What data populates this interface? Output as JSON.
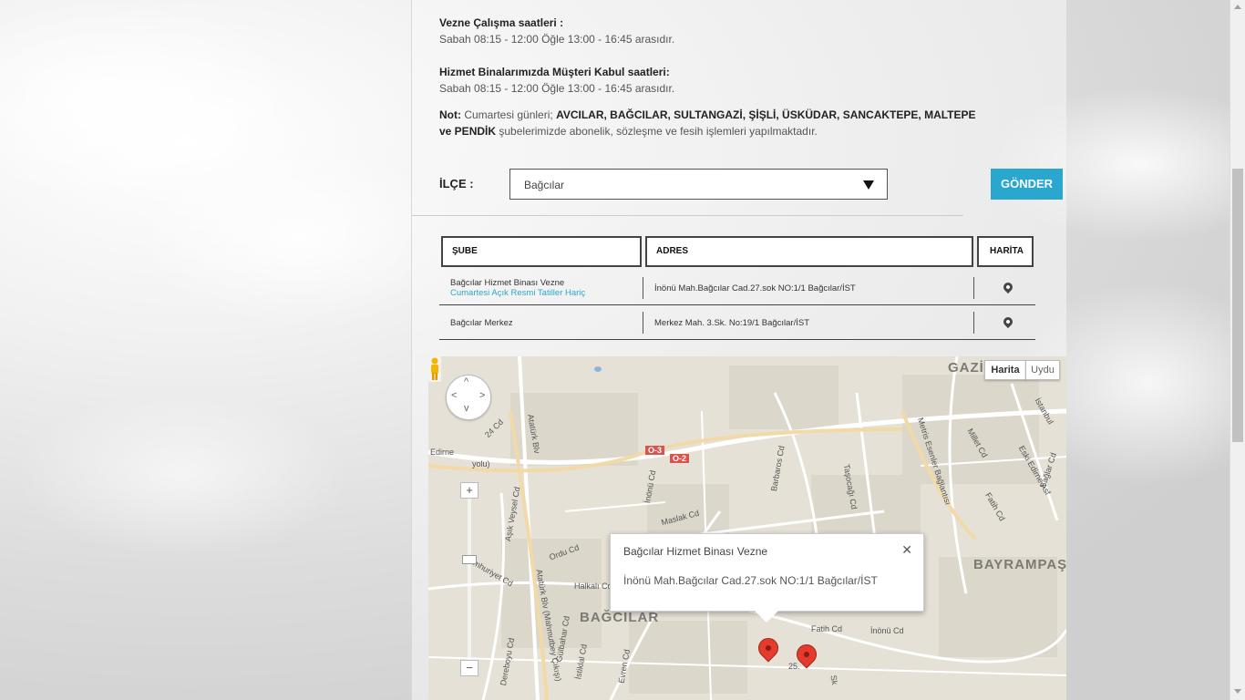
{
  "hours": {
    "cashier_title": "Vezne Çalışma saatleri :",
    "cashier_text": "Sabah 08:15 - 12:00 Öğle 13:00 - 16:45 arasıdır.",
    "service_title": "Hizmet Binalarımızda Müşteri Kabul saatleri:",
    "service_text": "Sabah 08:15 - 12:00 Öğle 13:00 - 16:45 arasıdır."
  },
  "note": {
    "label": "Not:",
    "prefix": "Cumartesi günleri;",
    "districts": "AVCILAR, BAĞCILAR, SULTANGAZİ, ŞİŞLİ, ÜSKÜDAR, SANCAKTEPE, MALTEPE",
    "districts2": "ve PENDİK",
    "suffix": "şubelerimizde abonelik, sözleşme ve fesih işlemleri yapılmaktadır."
  },
  "filter": {
    "label": "İLÇE :",
    "selected": "Bağcılar",
    "button": "GÖNDER"
  },
  "table": {
    "headers": [
      "ŞUBE",
      "ADRES",
      "HARİTA"
    ],
    "rows": [
      {
        "name": "Bağcılar Hizmet Binası Vezne",
        "sub": "Cumartesi Açık Resmi Tatiller Hariç",
        "address": "İnönü Mah.Bağcılar Cad.27.sok NO:1/1 Bağcılar/İST"
      },
      {
        "name": "Bağcılar Merkez",
        "sub": "",
        "address": "Merkez Mah. 3.Sk. No:19/1 Bağcılar/İST"
      }
    ]
  },
  "map": {
    "type_map": "Harita",
    "type_sat": "Uydu",
    "zoom_in": "+",
    "zoom_out": "−",
    "infowindow_title": "Bağcılar Hizmet Binası Vezne",
    "infowindow_address": "İnönü Mah.Bağcılar Cad.27.sok NO:1/1 Bağcılar/İST",
    "close": "✕",
    "areas": [
      "GAZİ",
      "BAYRAMPAŞA",
      "BAĞCILAR"
    ],
    "labels": [
      "Edirne",
      "yolu)",
      "24 Cd",
      "Atatürk Blv",
      "O-3",
      "O-2",
      "Maslak Cd",
      "İnönü Cd",
      "Barbaros Cd",
      "Taşocağı Cd",
      "Metris Esenler Bağlantısı",
      "Millet Cd",
      "Eski Edirne Asf",
      "Fatih Cd",
      "Aşık Veysel Cd",
      "Ordu Cd",
      "Halkalı Cd",
      "Cumhuriyet Cd",
      "Atatürk Blv (Mahmutbey Çıkışı)",
      "Gülbahar Cd",
      "Dereboyu Cd",
      "İstiklal Cd",
      "Evren Cd",
      "Fatih Cd",
      "İnönü Cd",
      "25.",
      "Sk",
      "Bağlar Cd",
      "İstanbul"
    ],
    "colors": {
      "land": "#e6e1d6",
      "road": "#ffffff",
      "highway": "#f2d9a8",
      "marker": "#e53b2f"
    }
  },
  "accent": "#2aa7cf"
}
